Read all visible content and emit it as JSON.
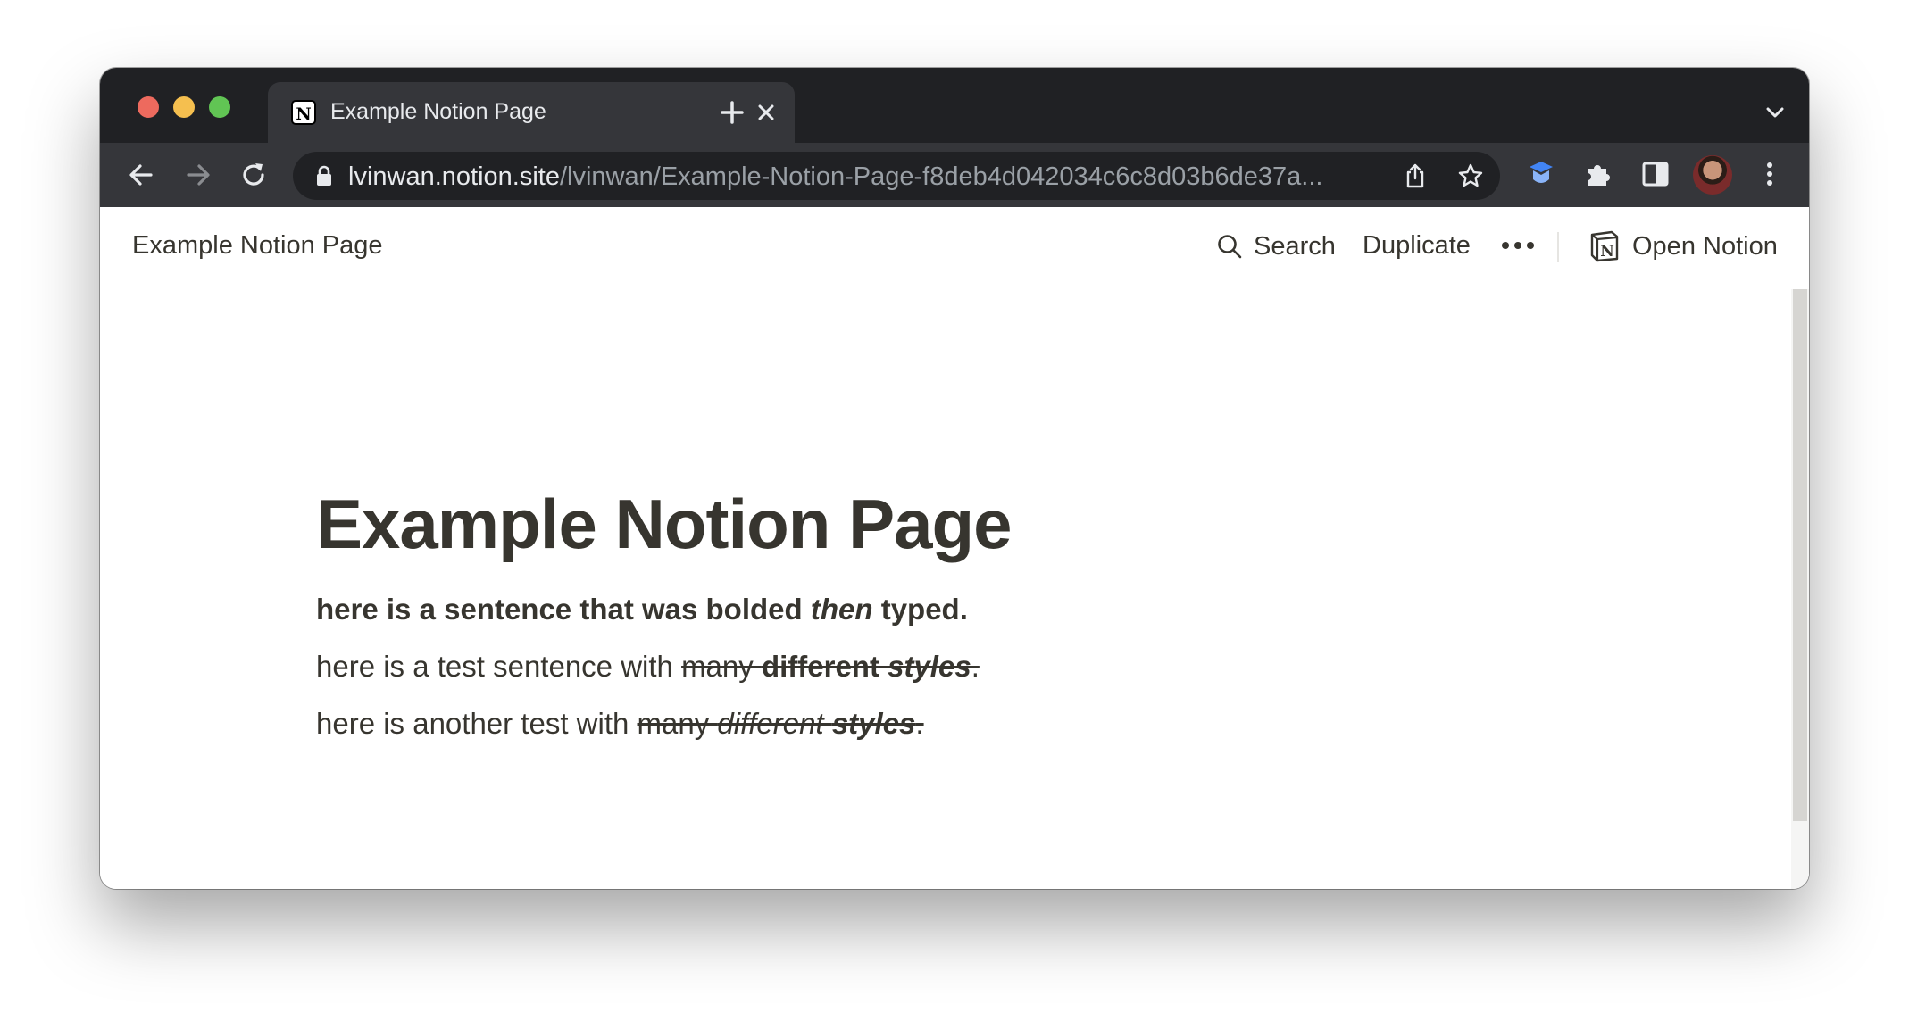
{
  "browser": {
    "tab": {
      "title": "Example Notion Page"
    },
    "url": {
      "host": "lvinwan.notion.site",
      "path": "/lvinwan/Example-Notion-Page-f8deb4d042034c6c8d03b6de37a..."
    },
    "icons": [
      "back-arrow-icon",
      "forward-arrow-icon",
      "reload-icon",
      "lock-icon",
      "share-icon",
      "star-icon",
      "extension-shield-icon",
      "puzzle-icon",
      "side-panel-icon",
      "kebab-menu-icon"
    ]
  },
  "notion": {
    "breadcrumb": "Example Notion Page",
    "topbar": {
      "search": "Search",
      "duplicate": "Duplicate",
      "open_notion": "Open Notion"
    },
    "page": {
      "title": "Example Notion Page",
      "p1": {
        "a": "here is a sentence that was bolded ",
        "b": "then",
        "c": " typed."
      },
      "p2": {
        "a": "here is a test sentence with ",
        "b": "many ",
        "c": "different ",
        "d": "styles",
        "e": "."
      },
      "p3": {
        "a": "here is another test with ",
        "b": "many ",
        "c": "different ",
        "d": "styles",
        "e": "."
      }
    }
  },
  "colors": {
    "text": "#37352f",
    "chrome_dark": "#202124",
    "chrome_tab": "#35363a"
  }
}
